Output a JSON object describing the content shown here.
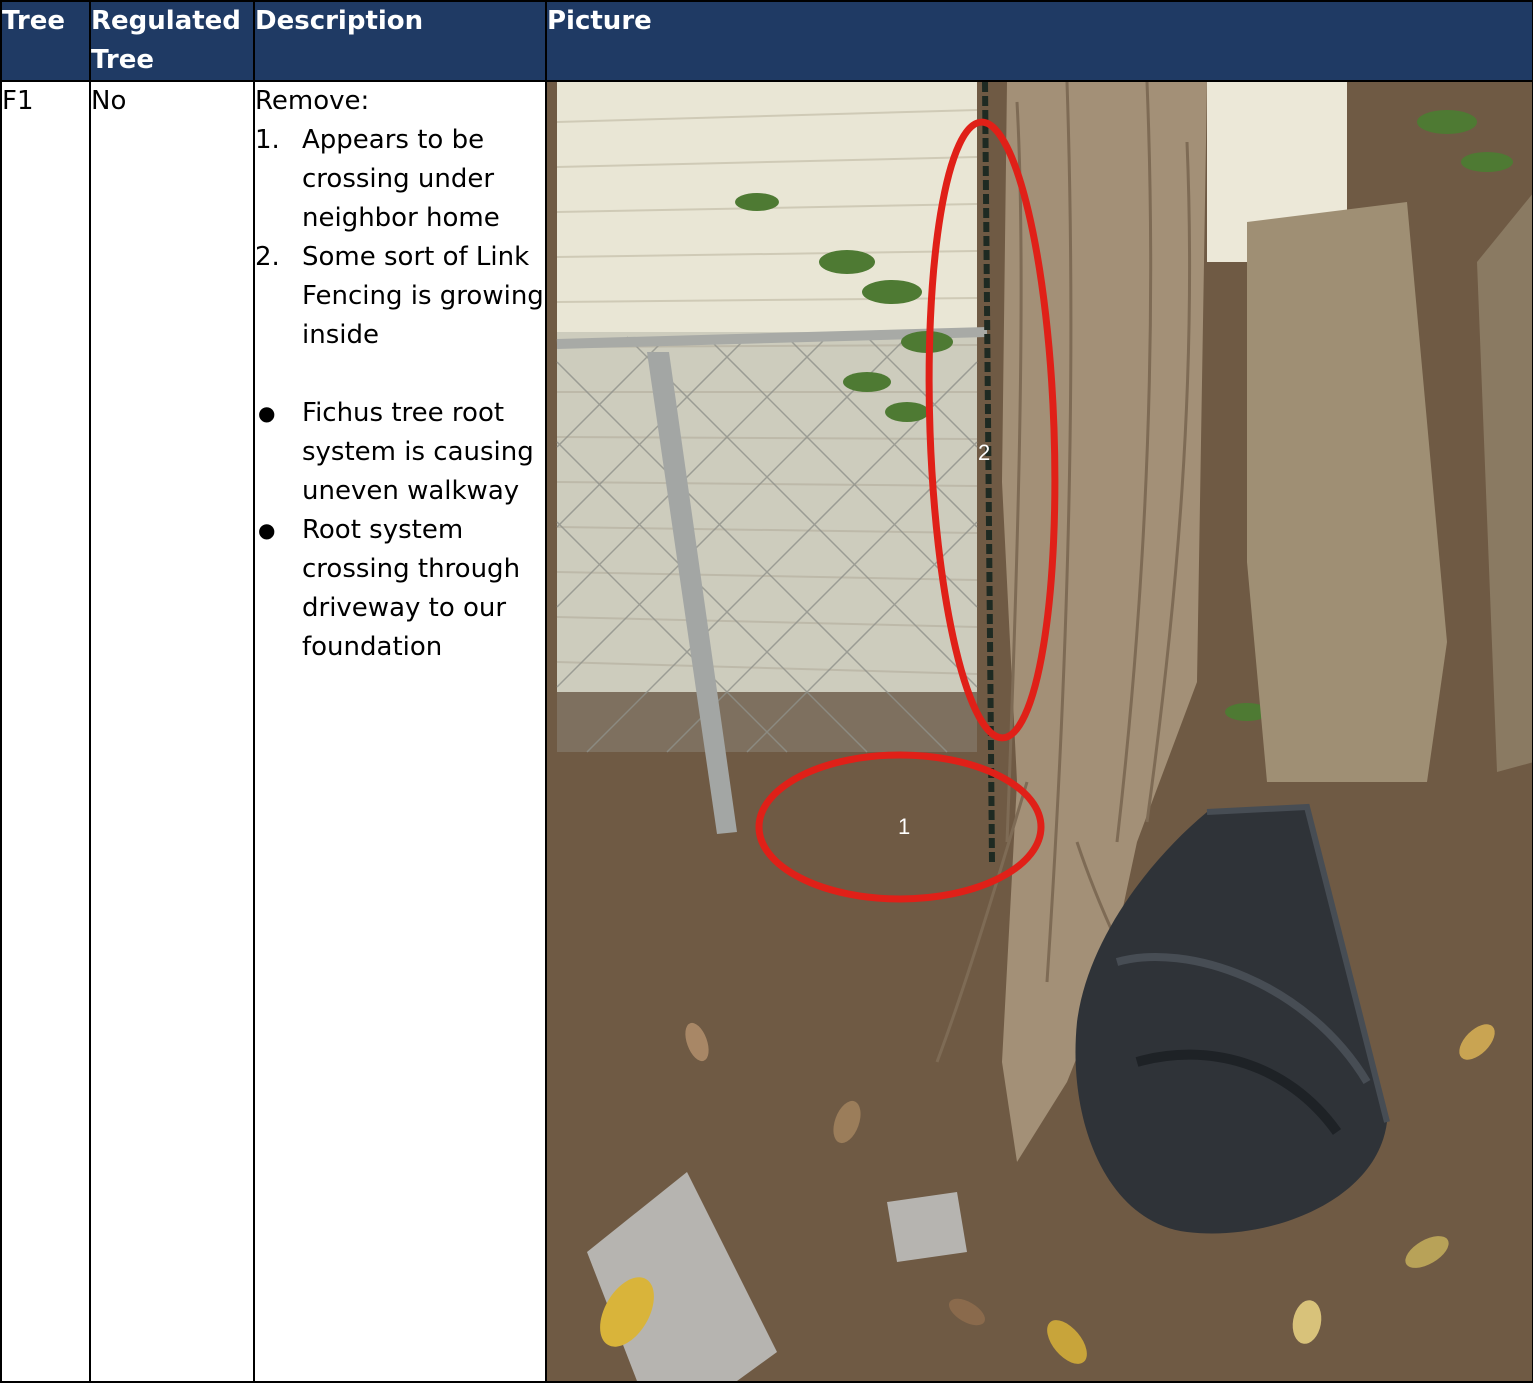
{
  "table": {
    "headers": {
      "tree": "Tree",
      "regulated": "Regulated Tree",
      "description": "Description",
      "picture": "Picture"
    },
    "rows": [
      {
        "tree": "F1",
        "regulated": "No",
        "description_heading": "Remove:",
        "numbered_items": [
          "Appears to be crossing under neighbor home",
          "Some sort of Link Fencing is growing inside"
        ],
        "bullet_items": [
          "Fichus tree root system is causing uneven walkway",
          "Root system crossing through driveway to our foundation"
        ],
        "picture": {
          "annotations": [
            "1",
            "2"
          ],
          "colors": {
            "circle": "#e02018",
            "house_siding": "#e9e6d5",
            "trunk": "#a39077",
            "bin_lid": "#2f3338",
            "leaves": "#6f5a44"
          }
        }
      }
    ]
  },
  "header_color": "#1f3a64"
}
